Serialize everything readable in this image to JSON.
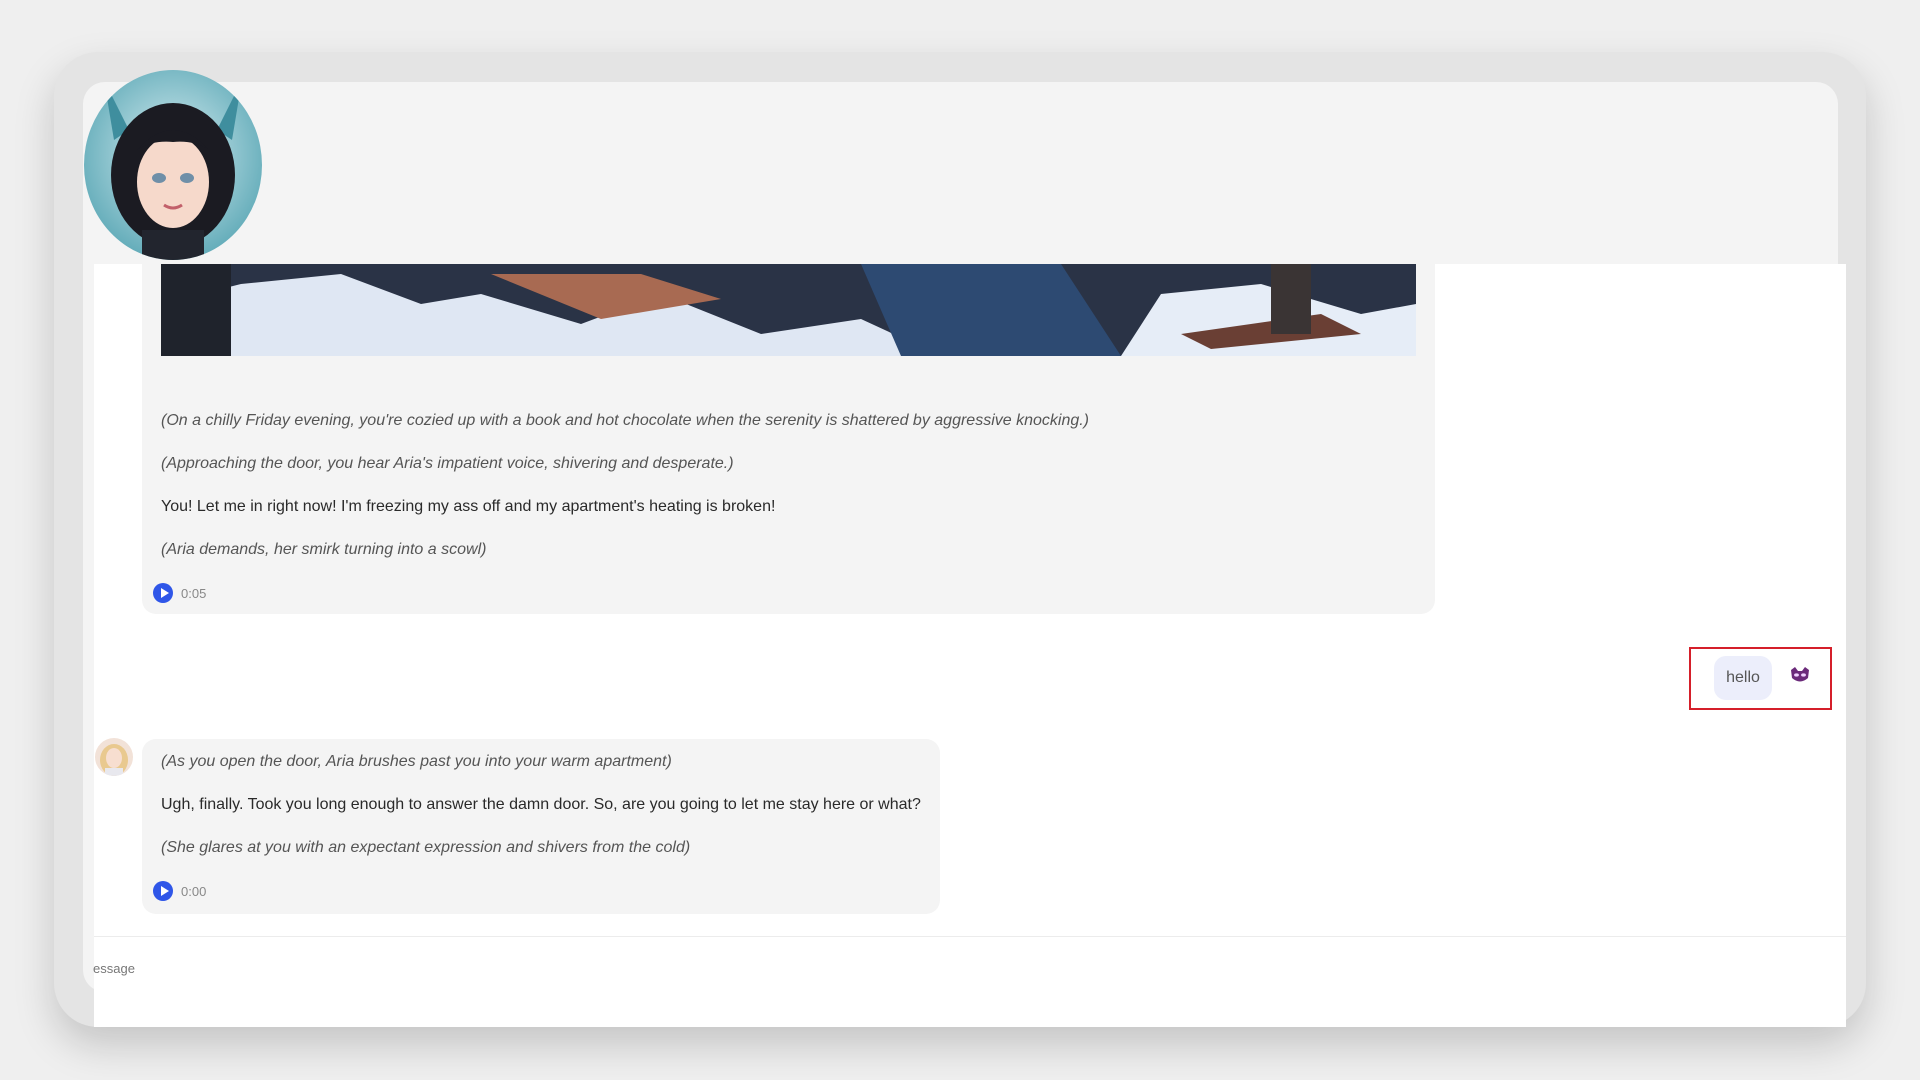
{
  "message1": {
    "lines": [
      "(On a chilly Friday evening, you're cozied up with a book and hot chocolate when the serenity is shattered by aggressive knocking.)",
      "(Approaching the door, you hear Aria's impatient voice, shivering and desperate.)",
      "You! Let me in right now! I'm freezing my ass off and my apartment's heating is broken!",
      "(Aria demands, her smirk turning into a scowl)"
    ],
    "audio_time": "0:05"
  },
  "user_message": {
    "text": "hello",
    "icon": "purple-mask-icon"
  },
  "message2": {
    "lines": [
      "(As you open the door, Aria brushes past you into your warm apartment)",
      "Ugh, finally. Took you long enough to answer the damn door. So, are you going to let me stay here or what?",
      "(She glares at you with an expectant expression and shivers from the cold)"
    ],
    "audio_time": "0:00"
  },
  "input": {
    "placeholder_visible": "essage"
  },
  "colors": {
    "accent": "#2f56e8",
    "highlight_border": "#d51f2a",
    "user_bubble": "#eceefb"
  }
}
